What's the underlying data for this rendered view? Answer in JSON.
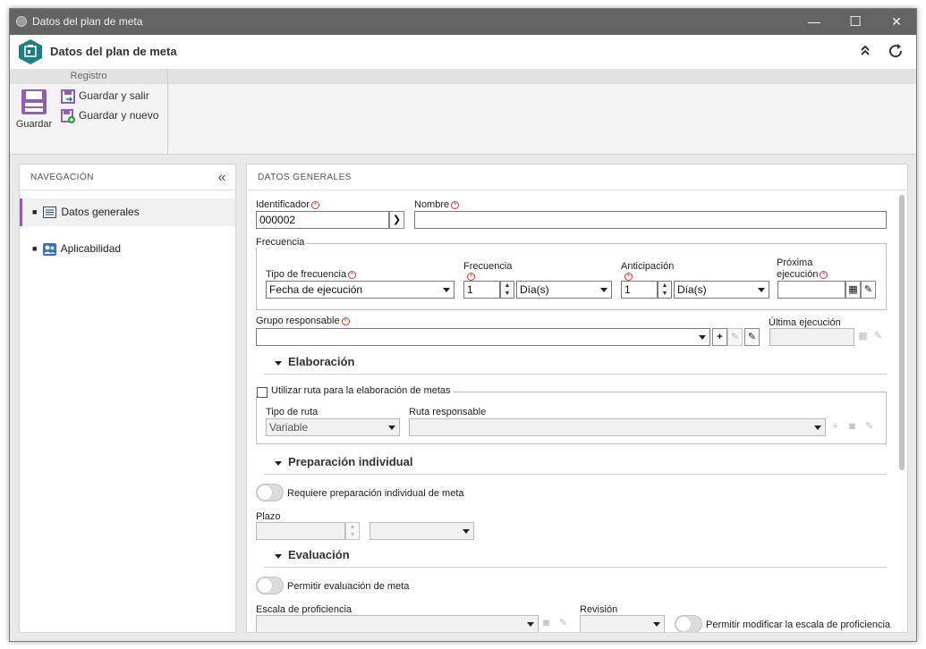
{
  "window": {
    "title": "Datos del plan de meta",
    "minimize": "—",
    "maximize": "☐",
    "close": "✕"
  },
  "header": {
    "title": "Datos del plan de meta"
  },
  "ribbon": {
    "group_label": "Registro",
    "save": "Guardar",
    "save_exit": "Guardar y salir",
    "save_new": "Guardar y nuevo"
  },
  "nav": {
    "title": "NAVEGACIÓN",
    "items": [
      {
        "label": "Datos generales"
      },
      {
        "label": "Aplicabilidad"
      }
    ]
  },
  "main": {
    "section_title": "DATOS GENERALES",
    "identifier": {
      "label": "Identificador",
      "value": "000002"
    },
    "name": {
      "label": "Nombre",
      "value": ""
    },
    "frequency": {
      "legend": "Frecuencia",
      "type_label": "Tipo de frecuencia",
      "type_value": "Fecha de ejecución",
      "freq_label": "Frecuencia",
      "freq_value": "1",
      "freq_unit": "Día(s)",
      "anticip_label": "Anticipación",
      "anticip_value": "1",
      "anticip_unit": "Día(s)",
      "next_label_1": "Próxima",
      "next_label_2": "ejecución"
    },
    "group": {
      "label": "Grupo responsable",
      "last_label": "Última ejecución"
    },
    "elaboration": {
      "title": "Elaboración",
      "checkbox_label": "Utilizar ruta para la elaboración de metas",
      "route_type_label": "Tipo de ruta",
      "route_type_value": "Variable",
      "route_resp_label": "Ruta responsable"
    },
    "individual": {
      "title": "Preparación individual",
      "toggle_label": "Requiere preparación individual de meta",
      "deadline_label": "Plazo"
    },
    "evaluation": {
      "title": "Evaluación",
      "toggle_label": "Permitir evaluación de meta",
      "scale_label": "Escala de proficiencia",
      "revision_label": "Revisión",
      "modify_label": "Permitir modificar la escala de proficiencia"
    }
  },
  "colors": {
    "accent": "#8e5fb5",
    "titlebar": "#646464",
    "brand": "#1b7f86"
  }
}
